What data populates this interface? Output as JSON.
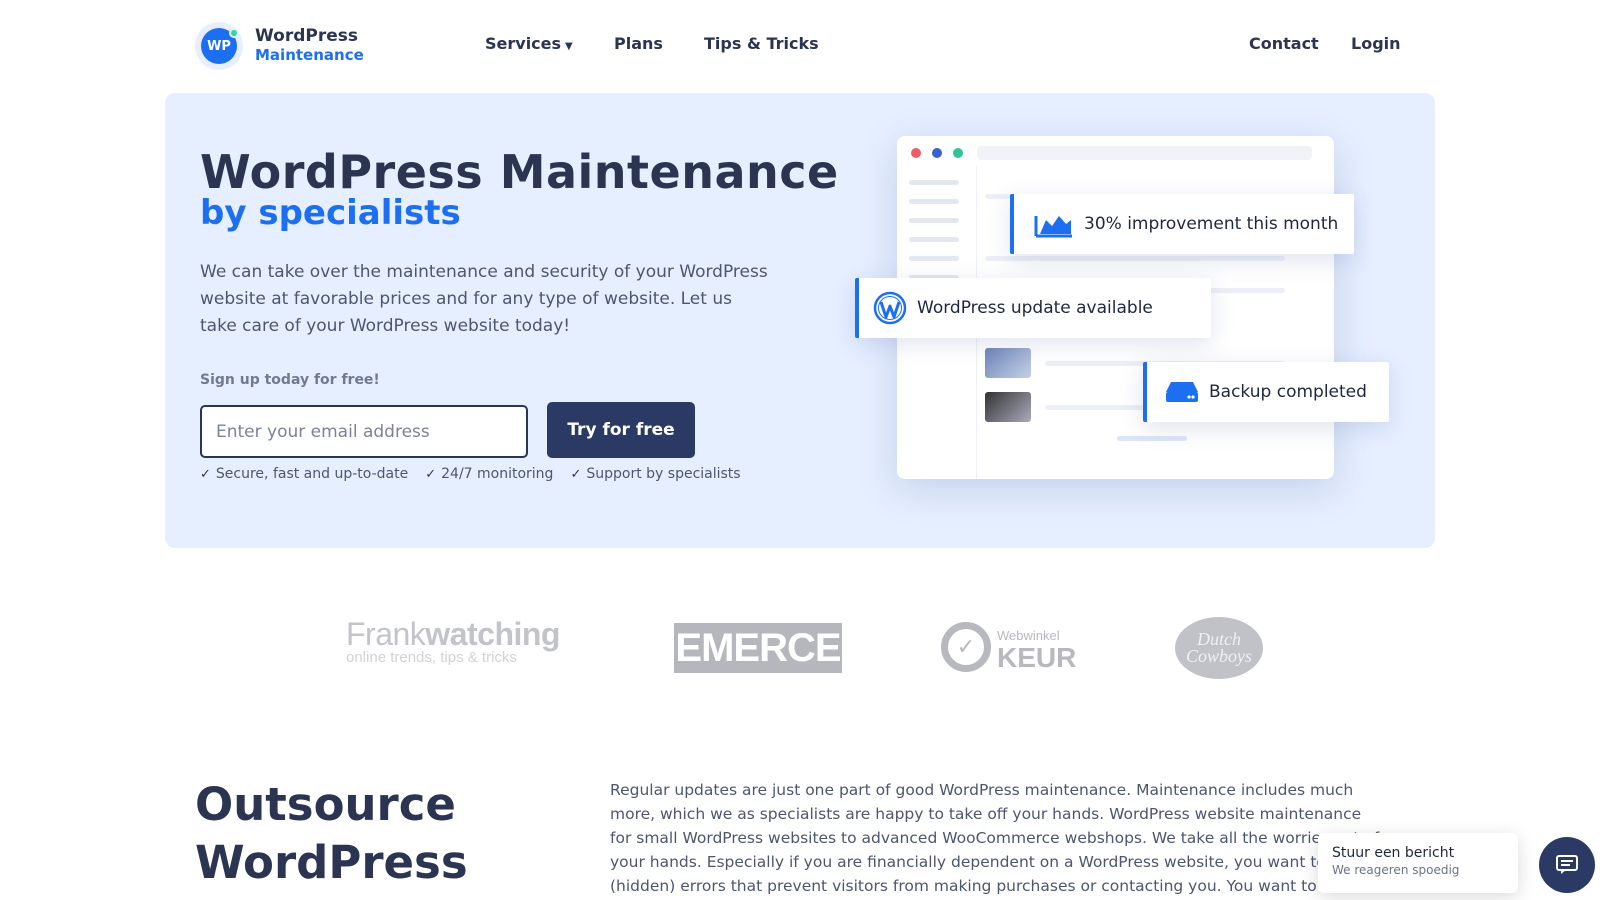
{
  "header": {
    "logo_line1": "WordPress",
    "logo_line2": "Maintenance",
    "logo_mark": "WP",
    "nav": {
      "services": "Services",
      "plans": "Plans",
      "tips": "Tips & Tricks",
      "contact": "Contact",
      "login": "Login"
    }
  },
  "hero": {
    "title": "WordPress Maintenance",
    "subtitle": "by specialists",
    "description": "We can take over the maintenance and security of your WordPress website at favorable prices and for any type of website. Let us take care of your WordPress website today!",
    "signup_label": "Sign up today for free!",
    "email_placeholder": "Enter your email address",
    "cta_label": "Try for free",
    "benefits": [
      "Secure, fast and up-to-date",
      "24/7 monitoring",
      "Support by specialists"
    ]
  },
  "notifications": {
    "improvement": "30% improvement this month",
    "update": "WordPress update available",
    "backup": "Backup completed"
  },
  "partners": {
    "frankwatching_a": "Frank",
    "frankwatching_b": "watching",
    "frankwatching_tagline": "online trends, tips & tricks",
    "emerce": "EMERCE",
    "keur_small": "Webwinkel",
    "keur_big": "KEUR",
    "dutch": "Dutch Cowboys"
  },
  "outsource": {
    "title_line1": "Outsource",
    "title_line2": "WordPress",
    "text": "Regular updates are just one part of good WordPress maintenance. Maintenance includes much more, which we as specialists are happy to take off your hands. WordPress website maintenance for small WordPress websites to advanced WooCommerce webshops. We take all the worries out of your hands. Especially if you are financially dependent on a WordPress website, you want to avoid (hidden) errors that prevent visitors from making purchases or contacting you. You want to prevent hacks and maint..."
  },
  "chat": {
    "title": "Stuur een bericht",
    "subtitle": "We reageren spoedig"
  },
  "colors": {
    "brand_blue": "#1d6ff2",
    "navy": "#2b3552",
    "button_navy": "#2b3a64",
    "hero_bg": "#e6efff"
  },
  "icons": [
    "chevron-down-icon",
    "check-icon",
    "area-chart-icon",
    "wordpress-icon",
    "server-icon",
    "chat-icon"
  ]
}
